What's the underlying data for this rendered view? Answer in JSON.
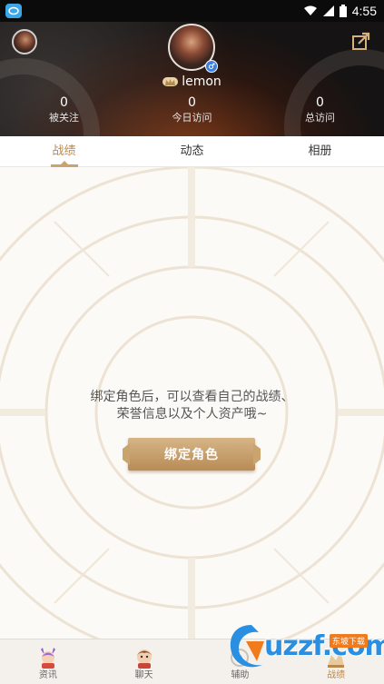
{
  "status_bar": {
    "time": "4:55",
    "icons": [
      "app-icon",
      "wifi-icon",
      "signal-icon",
      "battery-icon"
    ]
  },
  "profile": {
    "username": "lemon",
    "stats": [
      {
        "value": "0",
        "label": "被关注"
      },
      {
        "value": "0",
        "label": "今日访问"
      },
      {
        "value": "0",
        "label": "总访问"
      }
    ]
  },
  "tabs": [
    {
      "label": "战绩",
      "active": true
    },
    {
      "label": "动态",
      "active": false
    },
    {
      "label": "相册",
      "active": false
    }
  ],
  "empty_state": {
    "line1": "绑定角色后，可以查看自己的战绩、",
    "line2": "荣誉信息以及个人资产哦~",
    "button": "绑定角色"
  },
  "bottom_nav": [
    {
      "label": "资讯",
      "icon": "news-character-icon",
      "active": false
    },
    {
      "label": "聊天",
      "icon": "chat-character-icon",
      "active": false
    },
    {
      "label": "辅助",
      "icon": "assist-icon",
      "active": false
    },
    {
      "label": "战绩",
      "icon": "record-icon",
      "active": true
    }
  ],
  "watermark": {
    "text": "uzzf.com",
    "tag": "东坡下载"
  },
  "colors": {
    "accent": "#b8894e",
    "header_bg": "#141212",
    "button": "#c9a46e"
  }
}
